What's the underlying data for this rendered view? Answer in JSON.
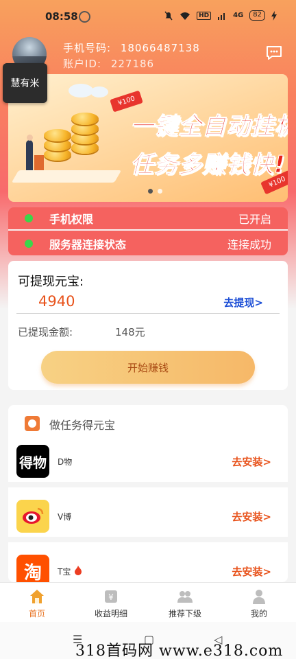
{
  "status_bar": {
    "time": "08:58",
    "battery": "82",
    "network_label": "HD",
    "signal_label": "4G"
  },
  "header": {
    "phone_label": "手机号码:",
    "phone_number": "18066487138",
    "account_label": "账户ID:",
    "account_id": "227186",
    "app_badge": "慧有米",
    "message_icon": "chat-bubble-icon"
  },
  "banner": {
    "line1": "一键全自动挂机",
    "line2": "任务多赚钱快!",
    "ticket_text": "¥100",
    "ticket_text2": "¥100",
    "colors": {
      "headline": "#e8231c"
    }
  },
  "status_card": {
    "rows": [
      {
        "label": "手机权限",
        "value": "已开启"
      },
      {
        "label": "服务器连接状态",
        "value": "连接成功"
      }
    ],
    "dot_color": "#3bd64a"
  },
  "balance": {
    "title": "可提现元宝:",
    "amount": "4940",
    "withdraw_link": "去提现>",
    "withdrawn_label": "已提现金额:",
    "withdrawn_value": "148元",
    "earn_button": "开始赚钱"
  },
  "tasks": {
    "title": "做任务得元宝",
    "items": [
      {
        "name": "D物",
        "logo_text": "得物",
        "install": "去安装>"
      },
      {
        "name": "V博",
        "logo_text": "",
        "install": "去安装>"
      },
      {
        "name": "T宝",
        "logo_text": "淘",
        "install": "去安装>"
      }
    ]
  },
  "bottom_nav": {
    "items": [
      {
        "label": "首页",
        "icon": "home-icon",
        "active": true
      },
      {
        "label": "收益明细",
        "icon": "income-detail-icon",
        "active": false
      },
      {
        "label": "推荐下级",
        "icon": "referral-icon",
        "active": false
      },
      {
        "label": "我的",
        "icon": "profile-icon",
        "active": false
      }
    ],
    "active_color": "#e87424"
  },
  "system_nav": {
    "menu": "☰",
    "home": "▢",
    "back": "◁"
  },
  "watermark": "318首码网  www.e318.com"
}
